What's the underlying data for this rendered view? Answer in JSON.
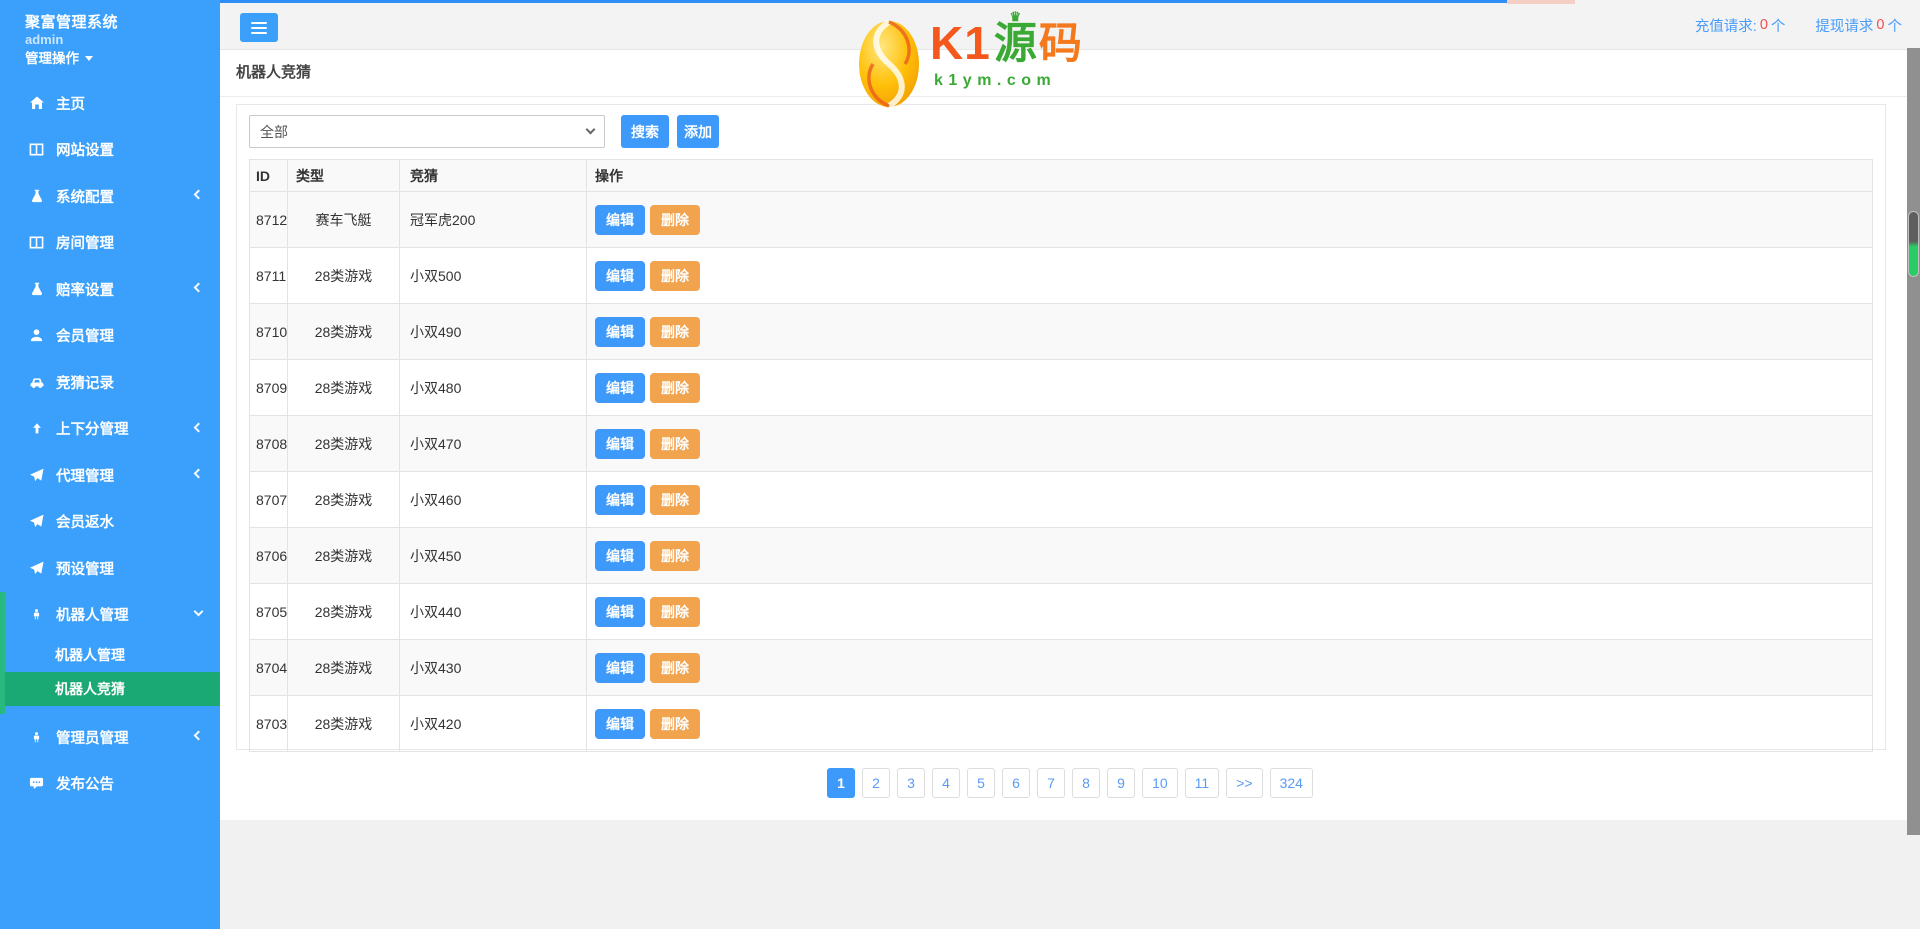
{
  "colors": {
    "accent": "#3aa0fb",
    "active_green": "#1aa874",
    "orange": "#f1a44d",
    "red": "#f05050",
    "logo_orange": "#f4581c",
    "logo_green": "#3aaa35"
  },
  "sidebar": {
    "brand": "聚富管理系统",
    "user": "admin",
    "menu_toggle": "管理操作",
    "items": [
      {
        "key": "home",
        "label": "主页",
        "icon": "home"
      },
      {
        "key": "site-settings",
        "label": "网站设置",
        "icon": "window"
      },
      {
        "key": "system-config",
        "label": "系统配置",
        "icon": "flask",
        "arrow": "left"
      },
      {
        "key": "room-management",
        "label": "房间管理",
        "icon": "window"
      },
      {
        "key": "odds-settings",
        "label": "赔率设置",
        "icon": "flask",
        "arrow": "left"
      },
      {
        "key": "member-management",
        "label": "会员管理",
        "icon": "user"
      },
      {
        "key": "bet-records",
        "label": "竞猜记录",
        "icon": "car"
      },
      {
        "key": "updown-score-management",
        "label": "上下分管理",
        "icon": "arrow-up",
        "arrow": "left"
      },
      {
        "key": "agent-management",
        "label": "代理管理",
        "icon": "plane",
        "arrow": "left"
      },
      {
        "key": "member-rebate",
        "label": "会员返水",
        "icon": "plane"
      },
      {
        "key": "preset-management",
        "label": "预设管理",
        "icon": "plane"
      },
      {
        "key": "robot-management",
        "label": "机器人管理",
        "icon": "person",
        "arrow": "down",
        "children": [
          {
            "key": "robot-management-sub",
            "label": "机器人管理"
          },
          {
            "key": "robot-bet",
            "label": "机器人竞猜",
            "active": true
          }
        ]
      },
      {
        "key": "admin-management",
        "label": "管理员管理",
        "icon": "person",
        "arrow": "left"
      },
      {
        "key": "announcement",
        "label": "发布公告",
        "icon": "comment"
      }
    ]
  },
  "topbar": {
    "requests": [
      {
        "label": "充值请求:",
        "count": "0",
        "suffix": "个"
      },
      {
        "label": "提现请求",
        "count": "0",
        "suffix": "个"
      }
    ]
  },
  "logo": {
    "k1": "K1",
    "yuan": "源",
    "ma": "码",
    "crown": "♛",
    "domain": "k1ym.com"
  },
  "page": {
    "title": "机器人竞猜"
  },
  "toolbar": {
    "filter_value": "全部",
    "search_label": "搜索",
    "add_label": "添加"
  },
  "table": {
    "headers": [
      "ID",
      "类型",
      "竞猜",
      "操作"
    ],
    "action_labels": [
      "编辑",
      "删除"
    ],
    "rows": [
      {
        "id": "8712",
        "type": "赛车飞艇",
        "guess": "冠军虎200"
      },
      {
        "id": "8711",
        "type": "28类游戏",
        "guess": "小双500"
      },
      {
        "id": "8710",
        "type": "28类游戏",
        "guess": "小双490"
      },
      {
        "id": "8709",
        "type": "28类游戏",
        "guess": "小双480"
      },
      {
        "id": "8708",
        "type": "28类游戏",
        "guess": "小双470"
      },
      {
        "id": "8707",
        "type": "28类游戏",
        "guess": "小双460"
      },
      {
        "id": "8706",
        "type": "28类游戏",
        "guess": "小双450"
      },
      {
        "id": "8705",
        "type": "28类游戏",
        "guess": "小双440"
      },
      {
        "id": "8704",
        "type": "28类游戏",
        "guess": "小双430"
      },
      {
        "id": "8703",
        "type": "28类游戏",
        "guess": "小双420"
      }
    ]
  },
  "pagination": {
    "pages": [
      "1",
      "2",
      "3",
      "4",
      "5",
      "6",
      "7",
      "8",
      "9",
      "10",
      "11",
      ">>",
      "324"
    ],
    "active": "1"
  }
}
